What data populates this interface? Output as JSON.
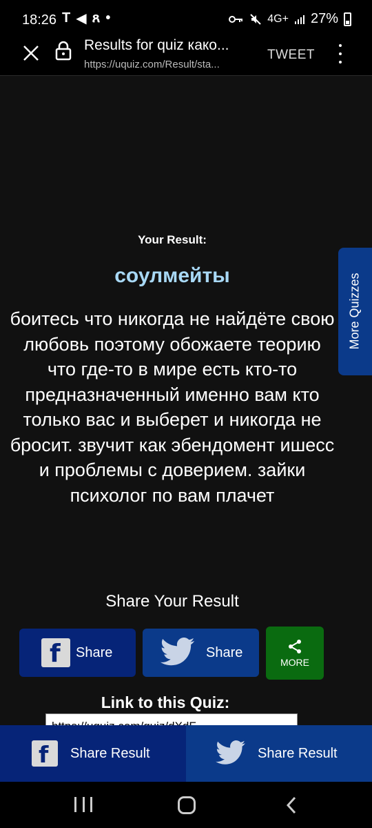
{
  "status_bar": {
    "time": "18:26",
    "left_icons": [
      "T",
      "◀",
      "ጸ",
      "•"
    ],
    "network": "4G+",
    "battery": "27%"
  },
  "browser": {
    "title": "Results for quiz како...",
    "url": "https://uquiz.com/Result/sta...",
    "tweet_label": "TWEET"
  },
  "result": {
    "label": "Your Result:",
    "title": "соулмейты",
    "description": "боитесь что никогда не найдёте свою любовь поэтому обожаете теорию что где-то в мире есть кто-то предназначенный именно вам кто только вас и выберет и никогда не бросит. звучит как эбендомент ишесс и проблемы с доверием. зайки психолог по вам плачет"
  },
  "more_quizzes": "More Quizzes",
  "share": {
    "heading": "Share Your Result",
    "facebook_label": "Share",
    "twitter_label": "Share",
    "more_label": "MORE",
    "facebook_glyph": "f"
  },
  "link": {
    "heading": "Link to this Quiz:",
    "value": "https://uquiz.com/quiz/dXdF"
  },
  "sticky": {
    "facebook_label": "Share Result",
    "twitter_label": "Share Result",
    "facebook_glyph": "f"
  },
  "colors": {
    "background": "#111111",
    "result_title": "#a8d8f5",
    "facebook_blue": "#062478",
    "twitter_blue": "#0b3a8a",
    "more_green": "#0a6b10"
  }
}
